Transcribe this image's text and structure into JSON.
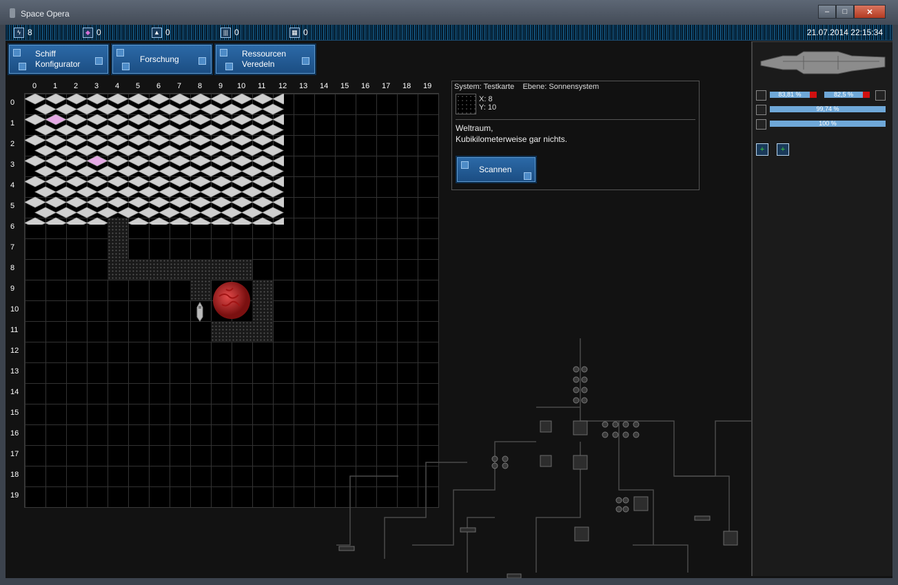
{
  "window": {
    "title": "Space Opera",
    "min": "‒",
    "max": "□",
    "close": "✕"
  },
  "status": {
    "resources": [
      {
        "icon": "lightning-icon",
        "glyph": "ϟ",
        "value": "8"
      },
      {
        "icon": "crystal-icon",
        "glyph": "◆",
        "value": "0"
      },
      {
        "icon": "triangle-icon",
        "glyph": "▲",
        "value": "0"
      },
      {
        "icon": "bars-icon",
        "glyph": "|||",
        "value": "0"
      },
      {
        "icon": "grid-icon",
        "glyph": "▦",
        "value": "0"
      }
    ],
    "datetime": "21.07.2014 22:15:34"
  },
  "toolbar": {
    "ship_line1": "Schiff",
    "ship_line2": "Konfigurator",
    "research": "Forschung",
    "res_line1": "Ressourcen",
    "res_line2": "Veredeln"
  },
  "map": {
    "col_labels": [
      "0",
      "1",
      "2",
      "3",
      "4",
      "5",
      "6",
      "7",
      "8",
      "9",
      "10",
      "11",
      "12",
      "13",
      "14",
      "15",
      "16",
      "17",
      "18",
      "19"
    ],
    "row_labels": [
      "0",
      "1",
      "2",
      "3",
      "4",
      "5",
      "6",
      "7",
      "8",
      "9",
      "10",
      "11",
      "12",
      "13",
      "14",
      "15",
      "16",
      "17",
      "18",
      "19"
    ]
  },
  "info": {
    "system_label": "System: Testkarte",
    "level_label": "Ebene: Sonnensystem",
    "x": "X:  8",
    "y": "Y:  10",
    "desc_line1": "Weltraum,",
    "desc_line2": "Kubikilometerweise gar nichts.",
    "scan_button": "Scannen"
  },
  "ship_stats": {
    "hull": "83,81 %",
    "shield": "82,5 %",
    "energy": "99,74 %",
    "fuel": "100 %"
  },
  "colors": {
    "accent": "#2c6aa8",
    "bar": "#6fa8d8",
    "alert": "#d01010",
    "planet": "#c0262a",
    "hex": "#cfcfcf",
    "highlight": "#e4a8e4"
  }
}
